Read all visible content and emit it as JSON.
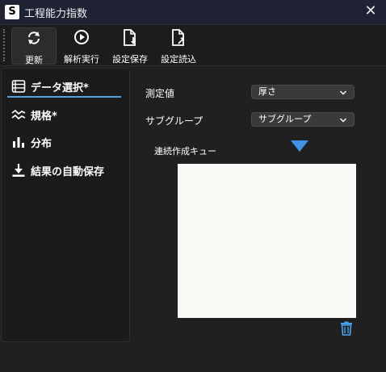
{
  "window": {
    "title": "工程能力指数",
    "app_letter": "S"
  },
  "toolbar": {
    "buttons": [
      {
        "id": "refresh",
        "label": "更新",
        "icon": "refresh-icon"
      },
      {
        "id": "run",
        "label": "解析実行",
        "icon": "play-icon"
      },
      {
        "id": "save",
        "label": "設定保存",
        "icon": "file-download-icon"
      },
      {
        "id": "load",
        "label": "設定読込",
        "icon": "file-upload-icon"
      }
    ]
  },
  "sidebar": {
    "items": [
      {
        "label": "データ選択*",
        "icon": "list-icon",
        "selected": true
      },
      {
        "label": "規格*",
        "icon": "wave-icon"
      },
      {
        "label": "分布",
        "icon": "bar-chart-icon"
      },
      {
        "label": "結果の自動保存",
        "icon": "download-icon"
      }
    ]
  },
  "main": {
    "measure_label": "測定値",
    "measure_value": "厚さ",
    "subgroup_label": "サブグループ",
    "subgroup_value": "サブグループ",
    "queue_label": "連続作成キュー",
    "queue_items": []
  },
  "colors": {
    "accent": "#4f9fe6",
    "arrow": "#3f94ea",
    "trash": "#4aa3f0"
  }
}
